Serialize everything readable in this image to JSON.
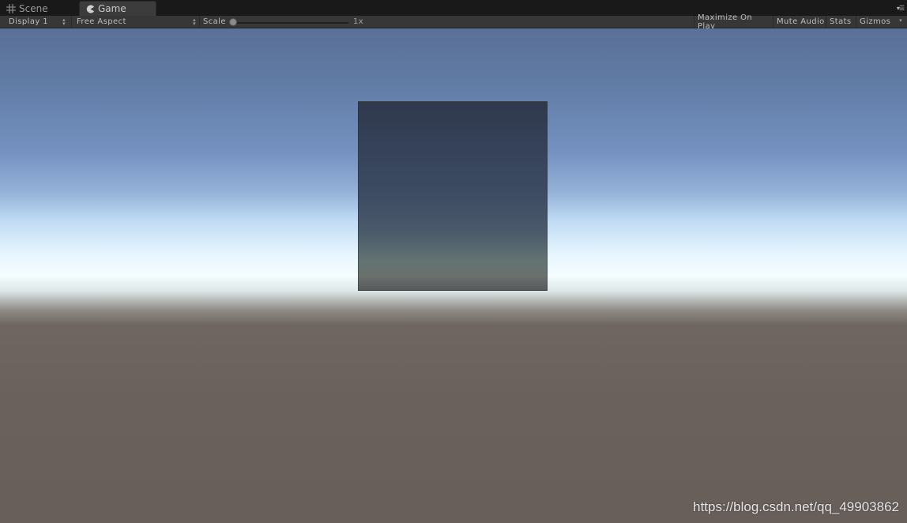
{
  "tabs": [
    {
      "label": "Scene",
      "icon": "grid-icon",
      "active": false
    },
    {
      "label": "Game",
      "icon": "pacman-icon",
      "active": true
    }
  ],
  "toolbar": {
    "display": "Display 1",
    "aspect": "Free Aspect",
    "scale_label": "Scale",
    "scale_value": "1x",
    "maximize_on_play": "Maximize On Play",
    "mute_audio": "Mute Audio",
    "stats": "Stats",
    "gizmos": "Gizmos"
  },
  "viewport": {
    "watermark": "https://blog.csdn.net/qq_49903862"
  },
  "colors": {
    "sky_top": "#5a7198",
    "horizon": "#f4fdff",
    "ground": "#6a615d",
    "cube_top": "#2f394c",
    "cube_bottom": "#575a5c"
  }
}
